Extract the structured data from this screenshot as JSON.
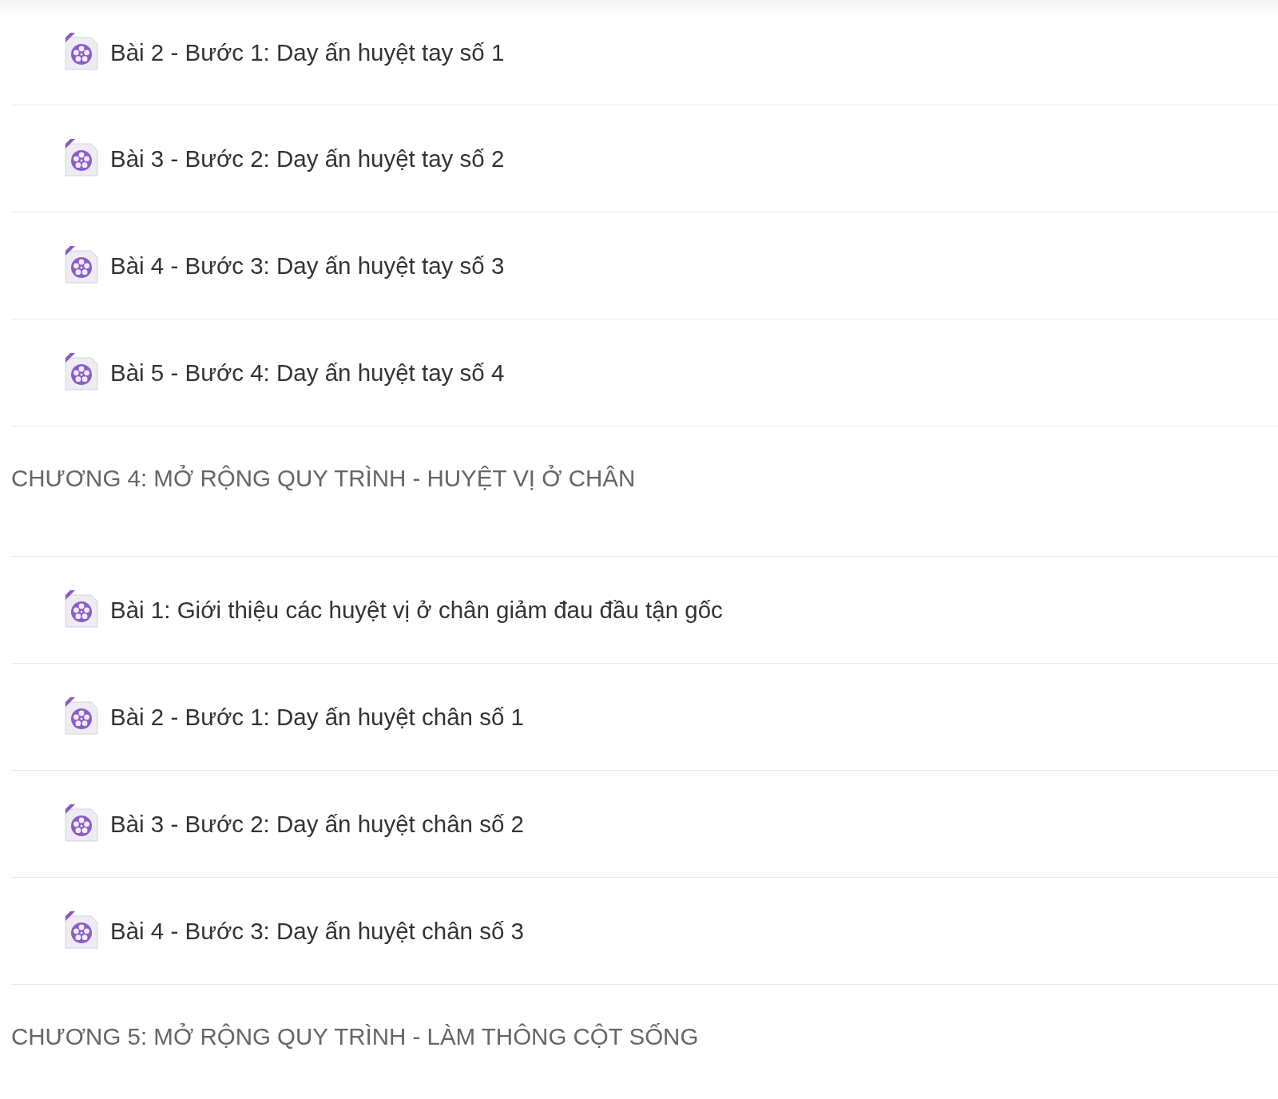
{
  "items": [
    {
      "kind": "lesson",
      "title": "Bài 2 - Bước 1: Day ấn huyệt tay số 1"
    },
    {
      "kind": "lesson",
      "title": "Bài 3 - Bước 2: Day ấn huyệt tay số 2"
    },
    {
      "kind": "lesson",
      "title": "Bài 4 - Bước 3: Day ấn huyệt tay số 3"
    },
    {
      "kind": "lesson",
      "title": "Bài 5 - Bước 4: Day ấn huyệt tay số 4"
    },
    {
      "kind": "chapter",
      "title": "CHƯƠNG 4: MỞ RỘNG QUY TRÌNH - HUYỆT VỊ Ở CHÂN"
    },
    {
      "kind": "lesson",
      "title": "Bài 1: Giới thiệu các huyệt vị ở chân giảm đau đầu tận gốc"
    },
    {
      "kind": "lesson",
      "title": "Bài 2 - Bước 1: Day ấn huyệt chân số 1"
    },
    {
      "kind": "lesson",
      "title": "Bài 3 - Bước 2: Day ấn huyệt chân số 2"
    },
    {
      "kind": "lesson",
      "title": "Bài 4 - Bước 3: Day ấn huyệt chân số 3"
    },
    {
      "kind": "chapter",
      "title": "CHƯƠNG 5: MỞ RỘNG QUY TRÌNH - LÀM THÔNG CỘT SỐNG"
    }
  ]
}
